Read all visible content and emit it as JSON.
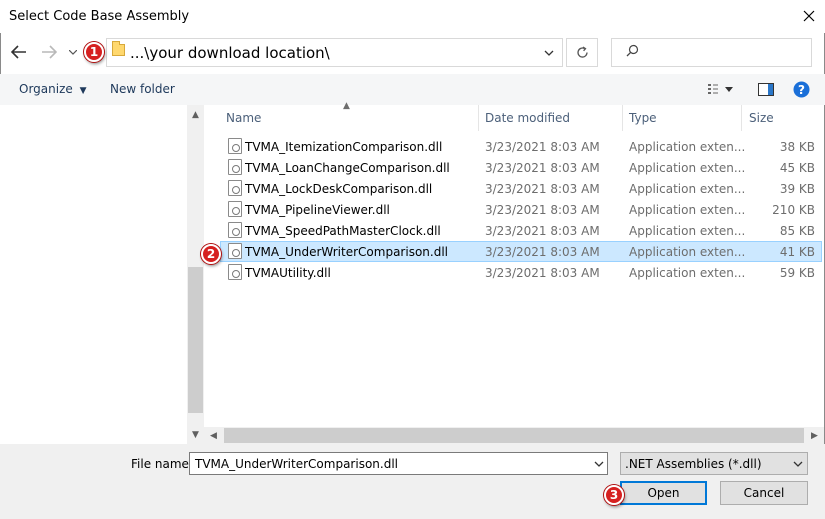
{
  "window": {
    "title": "Select Code Base Assembly"
  },
  "address": {
    "path": "...\\your download location\\"
  },
  "toolbar": {
    "organize_label": "Organize",
    "new_folder_label": "New folder"
  },
  "columns": {
    "name": "Name",
    "date": "Date modified",
    "type": "Type",
    "size": "Size"
  },
  "files": [
    {
      "name": "TVMA_ItemizationComparison.dll",
      "date": "3/23/2021 8:03 AM",
      "type": "Application exten...",
      "size": "38 KB"
    },
    {
      "name": "TVMA_LoanChangeComparison.dll",
      "date": "3/23/2021 8:03 AM",
      "type": "Application exten...",
      "size": "45 KB"
    },
    {
      "name": "TVMA_LockDeskComparison.dll",
      "date": "3/23/2021 8:03 AM",
      "type": "Application exten...",
      "size": "39 KB"
    },
    {
      "name": "TVMA_PipelineViewer.dll",
      "date": "3/23/2021 8:03 AM",
      "type": "Application exten...",
      "size": "210 KB"
    },
    {
      "name": "TVMA_SpeedPathMasterClock.dll",
      "date": "3/23/2021 8:03 AM",
      "type": "Application exten...",
      "size": "85 KB"
    },
    {
      "name": "TVMA_UnderWriterComparison.dll",
      "date": "3/23/2021 8:03 AM",
      "type": "Application exten...",
      "size": "41 KB"
    },
    {
      "name": "TVMAUtility.dll",
      "date": "3/23/2021 8:03 AM",
      "type": "Application exten...",
      "size": "59 KB"
    }
  ],
  "selected_index": 5,
  "filename": {
    "label": "File name:",
    "value": "TVMA_UnderWriterComparison.dll"
  },
  "filter": {
    "value": ".NET Assemblies (*.dll)"
  },
  "buttons": {
    "open": "Open",
    "cancel": "Cancel"
  },
  "badges": {
    "one": "1",
    "two": "2",
    "three": "3"
  },
  "icons": {
    "back": "arrow-left-icon",
    "forward": "arrow-right-icon",
    "recent": "chevron-down-icon",
    "refresh": "refresh-icon",
    "search": "search-icon",
    "close": "close-icon",
    "view": "view-details-icon",
    "preview": "preview-pane-icon",
    "help": "help-icon"
  },
  "colors": {
    "selected_row": "#cce8ff",
    "accent": "#0078d7",
    "badge": "#d62020",
    "help": "#1a6fd8"
  }
}
